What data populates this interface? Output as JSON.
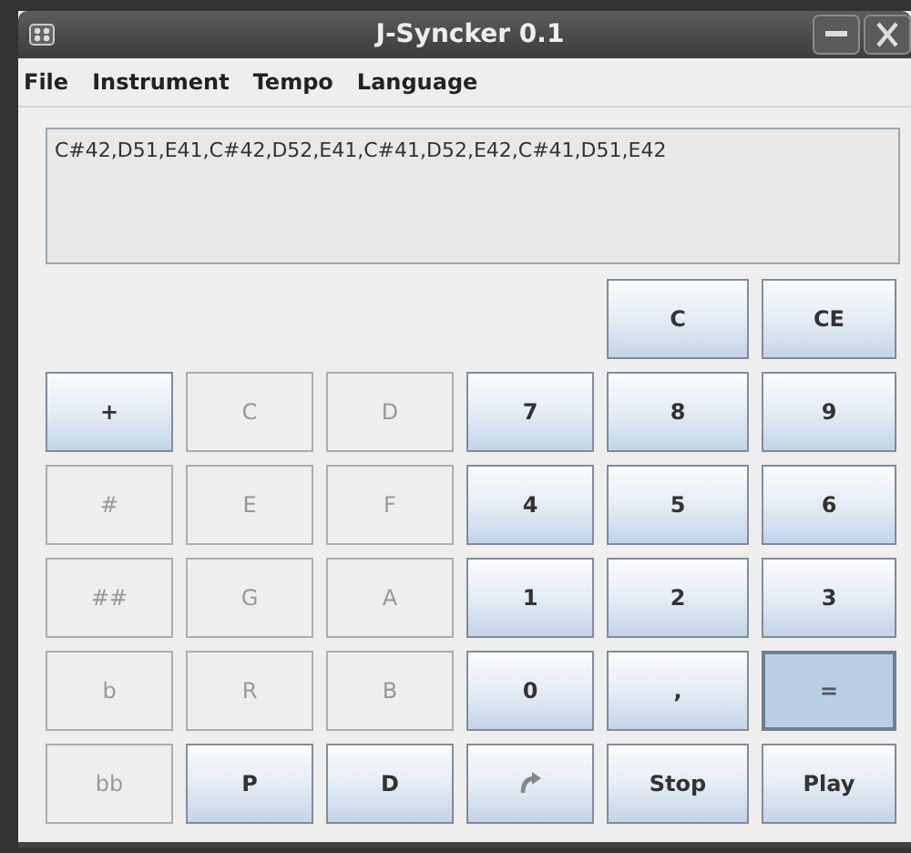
{
  "window": {
    "title": "J-Syncker 0.1"
  },
  "menu": [
    "File",
    "Instrument",
    "Tempo",
    "Language"
  ],
  "notes_display": {
    "value": "C#42,D51,E41,C#42,D52,E41,C#41,D52,E42,C#41,D51,E42"
  },
  "keys": [
    {
      "kind": "text",
      "label": "C",
      "disabled": false,
      "pressed": false
    },
    {
      "kind": "text",
      "label": "CE",
      "disabled": false,
      "pressed": false
    },
    {
      "kind": "text",
      "label": "+",
      "disabled": false,
      "pressed": false
    },
    {
      "kind": "text",
      "label": "C",
      "disabled": true,
      "pressed": false
    },
    {
      "kind": "text",
      "label": "D",
      "disabled": true,
      "pressed": false
    },
    {
      "kind": "text",
      "label": "7",
      "disabled": false,
      "pressed": false
    },
    {
      "kind": "text",
      "label": "8",
      "disabled": false,
      "pressed": false
    },
    {
      "kind": "text",
      "label": "9",
      "disabled": false,
      "pressed": false
    },
    {
      "kind": "text",
      "label": "#",
      "disabled": true,
      "pressed": false
    },
    {
      "kind": "text",
      "label": "E",
      "disabled": true,
      "pressed": false
    },
    {
      "kind": "text",
      "label": "F",
      "disabled": true,
      "pressed": false
    },
    {
      "kind": "text",
      "label": "4",
      "disabled": false,
      "pressed": false
    },
    {
      "kind": "text",
      "label": "5",
      "disabled": false,
      "pressed": false
    },
    {
      "kind": "text",
      "label": "6",
      "disabled": false,
      "pressed": false
    },
    {
      "kind": "text",
      "label": "##",
      "disabled": true,
      "pressed": false
    },
    {
      "kind": "text",
      "label": "G",
      "disabled": true,
      "pressed": false
    },
    {
      "kind": "text",
      "label": "A",
      "disabled": true,
      "pressed": false
    },
    {
      "kind": "text",
      "label": "1",
      "disabled": false,
      "pressed": false
    },
    {
      "kind": "text",
      "label": "2",
      "disabled": false,
      "pressed": false
    },
    {
      "kind": "text",
      "label": "3",
      "disabled": false,
      "pressed": false
    },
    {
      "kind": "text",
      "label": "b",
      "disabled": true,
      "pressed": false
    },
    {
      "kind": "text",
      "label": "R",
      "disabled": true,
      "pressed": false
    },
    {
      "kind": "text",
      "label": "B",
      "disabled": true,
      "pressed": false
    },
    {
      "kind": "text",
      "label": "0",
      "disabled": false,
      "pressed": false
    },
    {
      "kind": "text",
      "label": ",",
      "disabled": false,
      "pressed": false
    },
    {
      "kind": "text",
      "label": "=",
      "disabled": false,
      "pressed": true
    },
    {
      "kind": "text",
      "label": "bb",
      "disabled": true,
      "pressed": false
    },
    {
      "kind": "text",
      "label": "P",
      "disabled": false,
      "pressed": false
    },
    {
      "kind": "text",
      "label": "D",
      "disabled": false,
      "pressed": false
    },
    {
      "kind": "redo",
      "disabled": false,
      "pressed": false
    },
    {
      "kind": "text",
      "label": "Stop",
      "disabled": false,
      "pressed": false
    },
    {
      "kind": "text",
      "label": "Play",
      "disabled": false,
      "pressed": false
    }
  ]
}
